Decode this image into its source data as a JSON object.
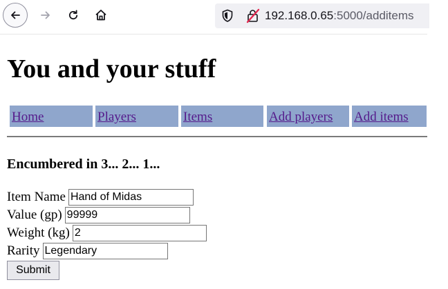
{
  "browser": {
    "url_host": "192.168.0.65",
    "url_path": ":5000/additems",
    "icons": {
      "back": "back-arrow-icon",
      "forward": "forward-arrow-icon",
      "reload": "reload-icon",
      "home": "home-icon",
      "tracking": "shield-icon",
      "insecure": "insecure-lock-icon"
    }
  },
  "page": {
    "title": "You and your stuff",
    "nav": [
      "Home",
      "Players",
      "Items",
      "Add players",
      "Add items"
    ],
    "subtitle": "Encumbered in 3... 2... 1...",
    "form": {
      "item_name": {
        "label": "Item Name",
        "value": "Hand of Midas"
      },
      "value_gp": {
        "label": "Value (gp)",
        "value": "99999"
      },
      "weight_kg": {
        "label": "Weight (kg)",
        "value": "2"
      },
      "rarity": {
        "label": "Rarity",
        "value": "Legendary"
      },
      "submit_label": "Submit"
    }
  },
  "colors": {
    "nav_background": "#8fa6cc",
    "link": "#551a8b"
  }
}
